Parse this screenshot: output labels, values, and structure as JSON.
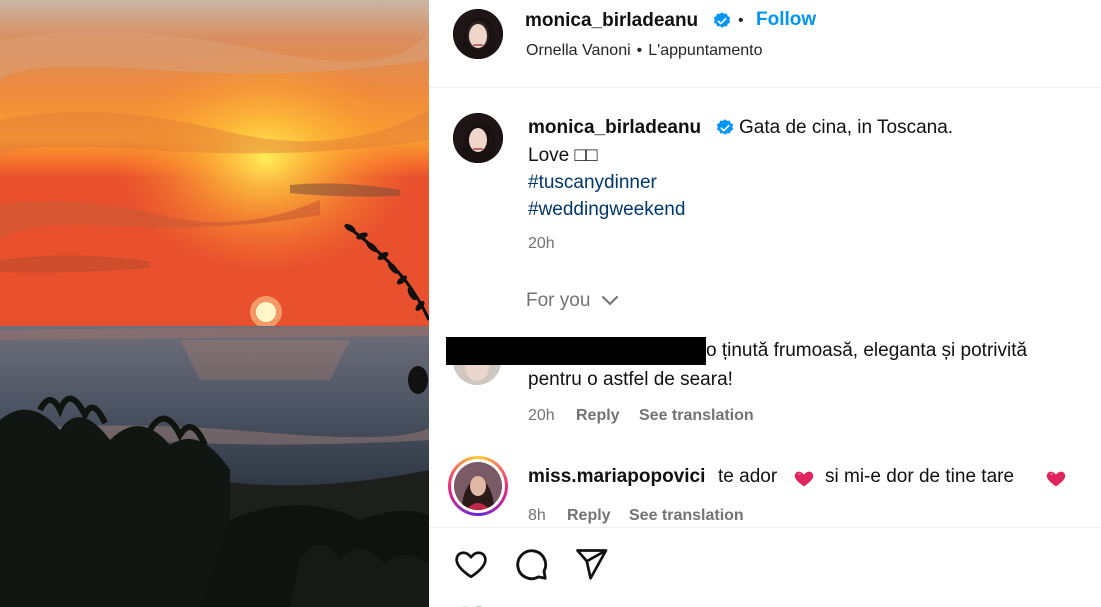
{
  "post": {
    "author": "monica_birladeanu",
    "follow_label": "Follow",
    "audio_artist": "Ornella Vanoni",
    "audio_separator": "•",
    "audio_title": "L'appuntamento",
    "caption_text": "Gata de cina, in Toscana.",
    "caption_line2": "Love □□",
    "hashtags": [
      "#tuscanydinner",
      "#weddingweekend"
    ],
    "caption_time": "20h"
  },
  "for_you": {
    "label": "For you"
  },
  "comments": [
    {
      "username": "",
      "text_line1": "o ținută frumoasă, eleganta și potrivită",
      "text_line2": "pentru o astfel de seara!",
      "time": "20h",
      "reply_label": "Reply",
      "translate_label": "See translation"
    },
    {
      "username": "miss.mariapopovici",
      "text_part1": "te ador",
      "text_part2": "si mi-e dor de tine tare",
      "time": "8h",
      "reply_label": "Reply",
      "translate_label": "See translation"
    }
  ],
  "actions": {
    "icons": [
      "heart-icon",
      "comment-icon",
      "share-icon"
    ]
  },
  "colors": {
    "accent": "#0095f6",
    "hashtag": "#00376b",
    "muted": "#737373",
    "verified": "#0095f6",
    "heart": "#e0245e"
  }
}
